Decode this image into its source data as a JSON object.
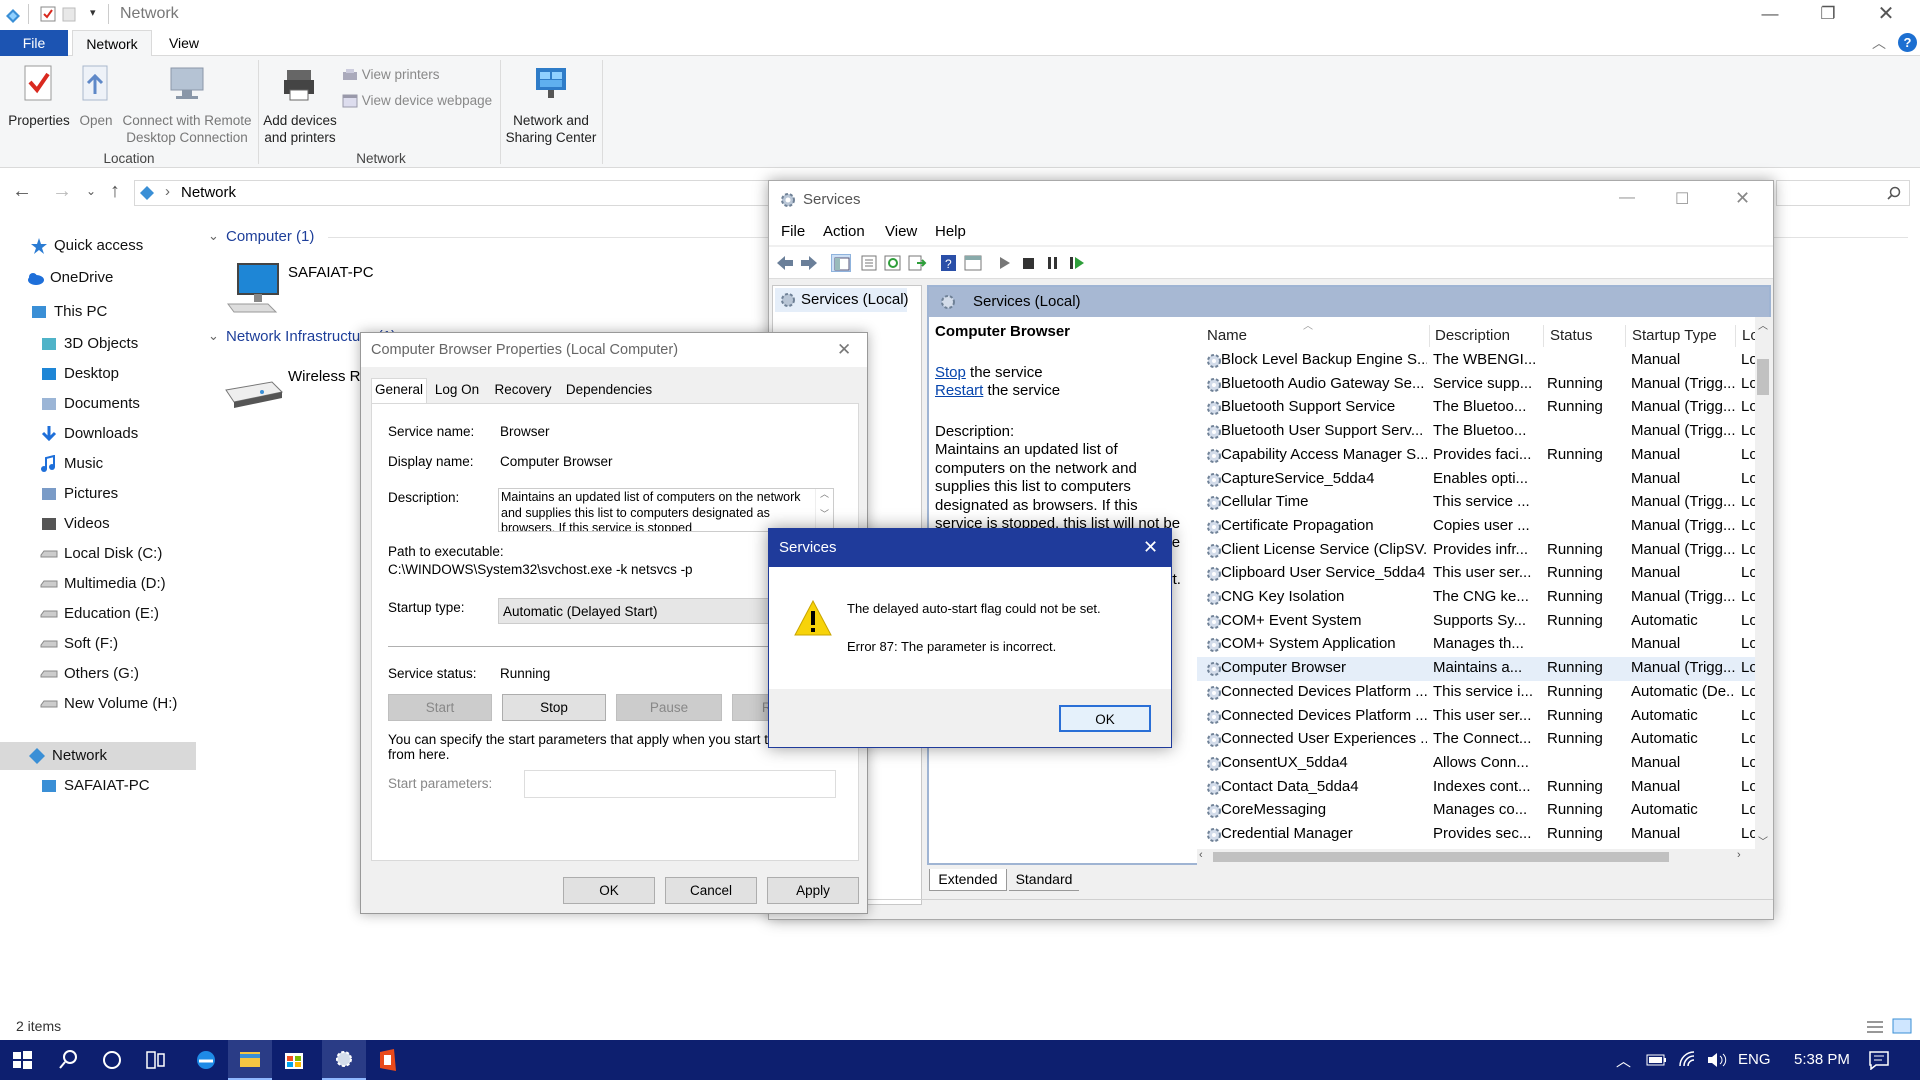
{
  "explorer": {
    "title": "Network",
    "tabs": [
      "File",
      "Network",
      "View"
    ],
    "ribbon": {
      "properties": "Properties",
      "open": "Open",
      "connect_remote": [
        "Connect with Remote",
        "Desktop Connection"
      ],
      "add_devices": [
        "Add devices",
        "and printers"
      ],
      "view_printers": "View printers",
      "view_device_webpage": "View device webpage",
      "network_sharing": [
        "Network and",
        "Sharing Center"
      ],
      "group_location": "Location",
      "group_network": "Network"
    },
    "address": "Network",
    "nav": [
      {
        "label": "Quick access",
        "icon": "star-icon"
      },
      {
        "label": "OneDrive",
        "icon": "cloud-icon"
      },
      {
        "label": "This PC",
        "icon": "computer-icon"
      },
      {
        "label": "3D Objects",
        "icon": "cube-icon"
      },
      {
        "label": "Desktop",
        "icon": "desktop-icon"
      },
      {
        "label": "Documents",
        "icon": "document-icon"
      },
      {
        "label": "Downloads",
        "icon": "download-icon"
      },
      {
        "label": "Music",
        "icon": "music-icon"
      },
      {
        "label": "Pictures",
        "icon": "picture-icon"
      },
      {
        "label": "Videos",
        "icon": "video-icon"
      },
      {
        "label": "Local Disk (C:)",
        "icon": "drive-icon"
      },
      {
        "label": "Multimedia (D:)",
        "icon": "drive-icon"
      },
      {
        "label": "Education (E:)",
        "icon": "drive-icon"
      },
      {
        "label": "Soft (F:)",
        "icon": "drive-icon"
      },
      {
        "label": "Others (G:)",
        "icon": "drive-icon"
      },
      {
        "label": "New Volume (H:)",
        "icon": "drive-icon"
      },
      {
        "label": "Network",
        "icon": "network-icon"
      },
      {
        "label": "SAFAIAT-PC",
        "icon": "computer-icon"
      }
    ],
    "groups": [
      {
        "title": "Computer (1)",
        "items": [
          "SAFAIAT-PC"
        ]
      },
      {
        "title": "Network Infrastructure (1)",
        "items": [
          "Wireless Router"
        ]
      }
    ],
    "status": "2 items"
  },
  "services": {
    "title": "Services",
    "menu": [
      "File",
      "Action",
      "View",
      "Help"
    ],
    "tree_item": "Services (Local)",
    "header": "Services (Local)",
    "selected_name": "Computer Browser",
    "stop_link": "Stop",
    "stop_text": " the service",
    "restart_link": "Restart",
    "restart_text": " the service",
    "desc_label": "Description:",
    "desc_text": "Maintains an updated list of computers on the network and supplies this list to computers designated as browsers. If this service is stopped, this list will not be updated or maintained. If this service is disabled, any services that explicitly depend on it will fail to start.",
    "columns": [
      "Name",
      "Description",
      "Status",
      "Startup Type",
      "Log"
    ],
    "rows": [
      [
        "Block Level Backup Engine S...",
        "The WBENGI...",
        "",
        "Manual",
        "Loc"
      ],
      [
        "Bluetooth Audio Gateway Se...",
        "Service supp...",
        "Running",
        "Manual (Trigg...",
        "Loc"
      ],
      [
        "Bluetooth Support Service",
        "The Bluetoo...",
        "Running",
        "Manual (Trigg...",
        "Loc"
      ],
      [
        "Bluetooth User Support Serv...",
        "The Bluetoo...",
        "",
        "Manual (Trigg...",
        "Loc"
      ],
      [
        "Capability Access Manager S...",
        "Provides faci...",
        "Running",
        "Manual",
        "Loc"
      ],
      [
        "CaptureService_5dda4",
        "Enables opti...",
        "",
        "Manual",
        "Loc"
      ],
      [
        "Cellular Time",
        "This service ...",
        "",
        "Manual (Trigg...",
        "Loc"
      ],
      [
        "Certificate Propagation",
        "Copies user ...",
        "",
        "Manual (Trigg...",
        "Loc"
      ],
      [
        "Client License Service (ClipSV...",
        "Provides infr...",
        "Running",
        "Manual (Trigg...",
        "Loc"
      ],
      [
        "Clipboard User Service_5dda4",
        "This user ser...",
        "Running",
        "Manual",
        "Loc"
      ],
      [
        "CNG Key Isolation",
        "The CNG ke...",
        "Running",
        "Manual (Trigg...",
        "Loc"
      ],
      [
        "COM+ Event System",
        "Supports Sy...",
        "Running",
        "Automatic",
        "Loc"
      ],
      [
        "COM+ System Application",
        "Manages th...",
        "",
        "Manual",
        "Loc"
      ],
      [
        "Computer Browser",
        "Maintains a...",
        "Running",
        "Manual (Trigg...",
        "Loc"
      ],
      [
        "Connected Devices Platform ...",
        "This service i...",
        "Running",
        "Automatic (De...",
        "Loc"
      ],
      [
        "Connected Devices Platform ...",
        "This user ser...",
        "Running",
        "Automatic",
        "Loc"
      ],
      [
        "Connected User Experiences ...",
        "The Connect...",
        "Running",
        "Automatic",
        "Loc"
      ],
      [
        "ConsentUX_5dda4",
        "Allows Conn...",
        "",
        "Manual",
        "Loc"
      ],
      [
        "Contact Data_5dda4",
        "Indexes cont...",
        "Running",
        "Manual",
        "Loc"
      ],
      [
        "CoreMessaging",
        "Manages co...",
        "Running",
        "Automatic",
        "Loc"
      ],
      [
        "Credential Manager",
        "Provides sec...",
        "Running",
        "Manual",
        "Loc"
      ]
    ],
    "bottom_tabs": [
      "Extended",
      "Standard"
    ]
  },
  "properties": {
    "title": "Computer Browser Properties (Local Computer)",
    "tabs": [
      "General",
      "Log On",
      "Recovery",
      "Dependencies"
    ],
    "service_name_label": "Service name:",
    "service_name": "Browser",
    "display_name_label": "Display name:",
    "display_name": "Computer Browser",
    "description_label": "Description:",
    "description": "Maintains an updated list of computers on the network and supplies this list to computers designated as browsers. If this service is stopped",
    "path_label": "Path to executable:",
    "path": "C:\\WINDOWS\\System32\\svchost.exe -k netsvcs -p",
    "startup_label": "Startup type:",
    "startup_value": "Automatic (Delayed Start)",
    "status_label": "Service status:",
    "status_value": "Running",
    "btn_start": "Start",
    "btn_stop": "Stop",
    "btn_pause": "Pause",
    "btn_resume": "Resume",
    "hint": "You can specify the start parameters that apply when you start the service from here.",
    "params_label": "Start parameters:",
    "params_value": "",
    "ok": "OK",
    "cancel": "Cancel",
    "apply": "Apply"
  },
  "error": {
    "title": "Services",
    "line1": "The delayed auto-start flag could not be set.",
    "line2": "Error 87: The parameter is incorrect.",
    "ok": "OK"
  },
  "taskbar": {
    "lang": "ENG",
    "time": "5:38 PM"
  },
  "colors": {
    "accent": "#1f3b9b",
    "file_tab": "#1c54b2",
    "taskbar": "#0d1f6f",
    "svc_header": "#a7b8d3",
    "link": "#0645ad",
    "warning": "#f7d30a"
  }
}
